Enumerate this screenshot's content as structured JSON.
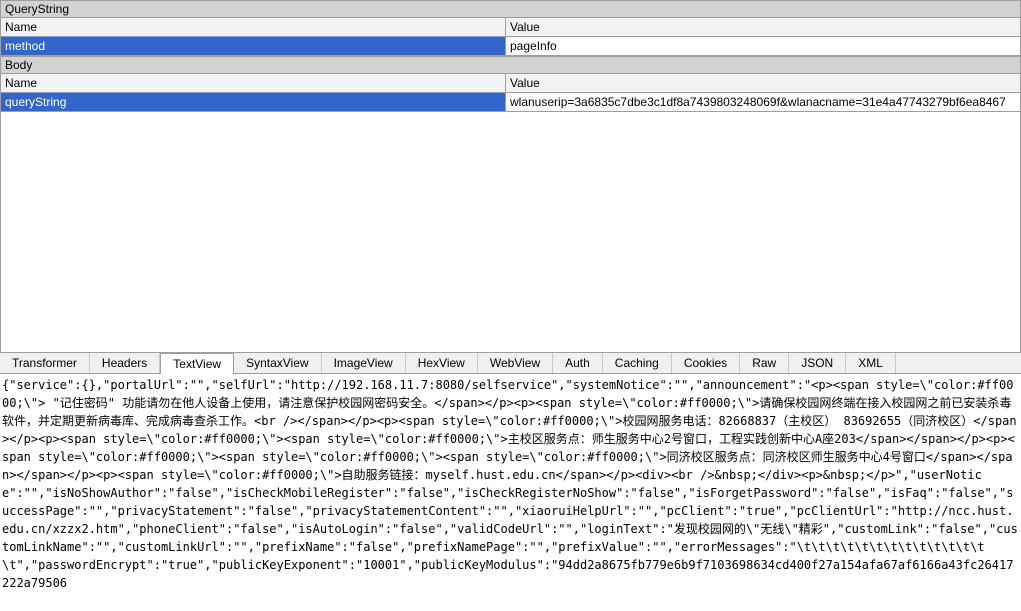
{
  "section_querystring": {
    "title": "QueryString"
  },
  "section_body": {
    "title": "Body"
  },
  "columns": {
    "name": "Name",
    "value": "Value"
  },
  "qs_rows": [
    {
      "name": "method",
      "value": "pageInfo"
    }
  ],
  "body_rows": [
    {
      "name": "queryString",
      "value": "wlanuserip=3a6835c7dbe3c1df8a7439803248069f&wlanacname=31e4a47743279bf6ea8467"
    }
  ],
  "tabs": {
    "transformer": "Transformer",
    "headers": "Headers",
    "textview": "TextView",
    "syntaxview": "SyntaxView",
    "imageview": "ImageView",
    "hexview": "HexView",
    "webview": "WebView",
    "auth": "Auth",
    "caching": "Caching",
    "cookies": "Cookies",
    "raw": "Raw",
    "json": "JSON",
    "xml": "XML"
  },
  "textview_content": "{\"service\":{},\"portalUrl\":\"\",\"selfUrl\":\"http://192.168.11.7:8080/selfservice\",\"systemNotice\":\"\",\"announcement\":\"<p><span style=\\\"color:#ff0000;\\\"> \"记住密码\" 功能请勿在他人设备上使用，请注意保护校园网密码安全。</span></p><p><span style=\\\"color:#ff0000;\\\">请确保校园网终端在接入校园网之前已安装杀毒软件，并定期更新病毒库、完成病毒查杀工作。<br /></span></p><p><span style=\\\"color:#ff0000;\\\">校园网服务电话：82668837（主校区） 83692655（同济校区）</span></p><p><span style=\\\"color:#ff0000;\\\"><span style=\\\"color:#ff0000;\\\">主校区服务点：师生服务中心2号窗口，工程实践创新中心A座203</span></span></p><p><span style=\\\"color:#ff0000;\\\"><span style=\\\"color:#ff0000;\\\"><span style=\\\"color:#ff0000;\\\">同济校区服务点：同济校区师生服务中心4号窗口</span></span></span></p><p><span style=\\\"color:#ff0000;\\\">自助服务链接：myself.hust.edu.cn</span></p><div><br />&nbsp;</div><p>&nbsp;</p>\",\"userNotice\":\"\",\"isNoShowAuthor\":\"false\",\"isCheckMobileRegister\":\"false\",\"isCheckRegisterNoShow\":\"false\",\"isForgetPassword\":\"false\",\"isFaq\":\"false\",\"successPage\":\"\",\"privacyStatement\":\"false\",\"privacyStatementContent\":\"\",\"xiaoruiHelpUrl\":\"\",\"pcClient\":\"true\",\"pcClientUrl\":\"http://ncc.hust.edu.cn/xzzx2.htm\",\"phoneClient\":\"false\",\"isAutoLogin\":\"false\",\"validCodeUrl\":\"\",\"loginText\":\"发现校园网的\\\"无线\\\"精彩\",\"customLink\":\"false\",\"customLinkName\":\"\",\"customLinkUrl\":\"\",\"prefixName\":\"false\",\"prefixNamePage\":\"\",\"prefixValue\":\"\",\"errorMessages\":\"\\t\\t\\t\\t\\t\\t\\t\\t\\t\\t\\t\\t\\t\\t\",\"passwordEncrypt\":\"true\",\"publicKeyExponent\":\"10001\",\"publicKeyModulus\":\"94dd2a8675fb779e6b9f7103698634cd400f27a154afa67af6166a43fc26417222a79506"
}
